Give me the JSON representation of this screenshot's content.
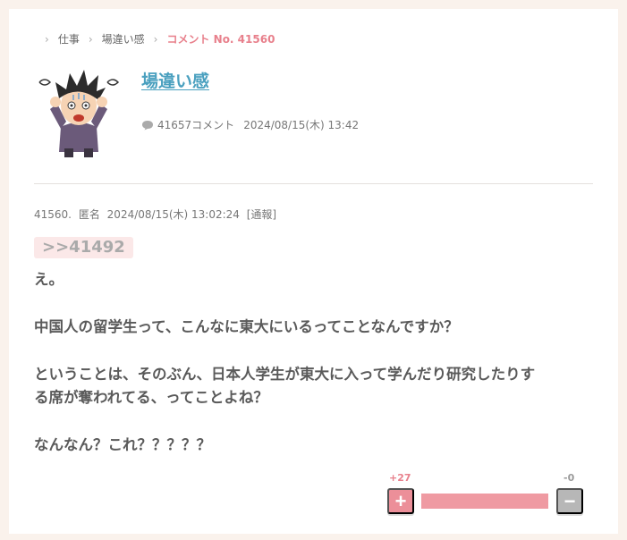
{
  "breadcrumb": {
    "items": [
      {
        "label": "仕事"
      },
      {
        "label": "場違い感"
      },
      {
        "label": "コメント No. 41560"
      }
    ]
  },
  "topic": {
    "title": "場違い感",
    "comment_count": "41657コメント",
    "date": "2024/08/15(木) 13:42",
    "thumbnail_icon": "confused-man-illustration"
  },
  "comment": {
    "number": "41560.",
    "author": "匿名",
    "posted": "2024/08/15(木) 13:02:24",
    "report_label": "[通報]",
    "anchor": ">>41492",
    "lines": [
      "え。",
      "",
      "中国人の留学生って、こんなに東大にいるってことなんですか？",
      "",
      "ということは、そのぶん、日本人学生が東大に入って学んだり研究したりす",
      "る席が奪われてる、ってことよね？",
      "",
      "なんなん？これ？？？？？"
    ]
  },
  "votes": {
    "plus_count": "+27",
    "minus_count": "-0",
    "plus_label": "+",
    "minus_label": "−",
    "plus_ratio": 1.0,
    "colors": {
      "plus": "#ec8f99",
      "minus": "#b7b7b7",
      "bar_plus": "#ef9aa2"
    }
  }
}
